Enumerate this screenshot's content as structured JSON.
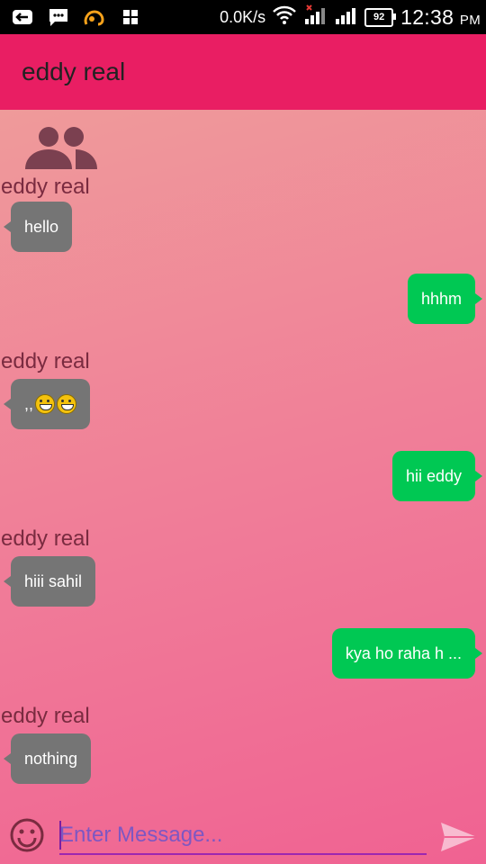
{
  "status_bar": {
    "net_speed": "0.0K/s",
    "battery": "92",
    "time": "12:38",
    "ampm": "PM",
    "icons": [
      "usb-icon",
      "message-icon",
      "uc-browser-icon",
      "grid-icon",
      "wifi-icon",
      "signal-icon",
      "signal-2-icon"
    ]
  },
  "toolbar": {
    "title": "eddy real"
  },
  "chat": {
    "group_icon": "group-icon",
    "messages": [
      {
        "direction": "in",
        "sender": "eddy real",
        "text": "hello"
      },
      {
        "direction": "out",
        "text": "hhhm"
      },
      {
        "direction": "in",
        "sender": "eddy real",
        "text": ",,",
        "emoji_count": 2
      },
      {
        "direction": "out",
        "text": "hii eddy"
      },
      {
        "direction": "in",
        "sender": "eddy real",
        "text": "hiii sahil"
      },
      {
        "direction": "out",
        "text": "kya ho raha h ..."
      },
      {
        "direction": "in",
        "sender": "eddy real",
        "text": "nothing"
      }
    ]
  },
  "composer": {
    "placeholder": "Enter Message...",
    "value": "",
    "emoji_icon": "smiley-icon",
    "send_icon": "send-icon"
  },
  "colors": {
    "toolbar": "#e91e63",
    "incoming_bubble": "#757575",
    "outgoing_bubble": "#00c853",
    "input_underline": "#9c27b0"
  }
}
